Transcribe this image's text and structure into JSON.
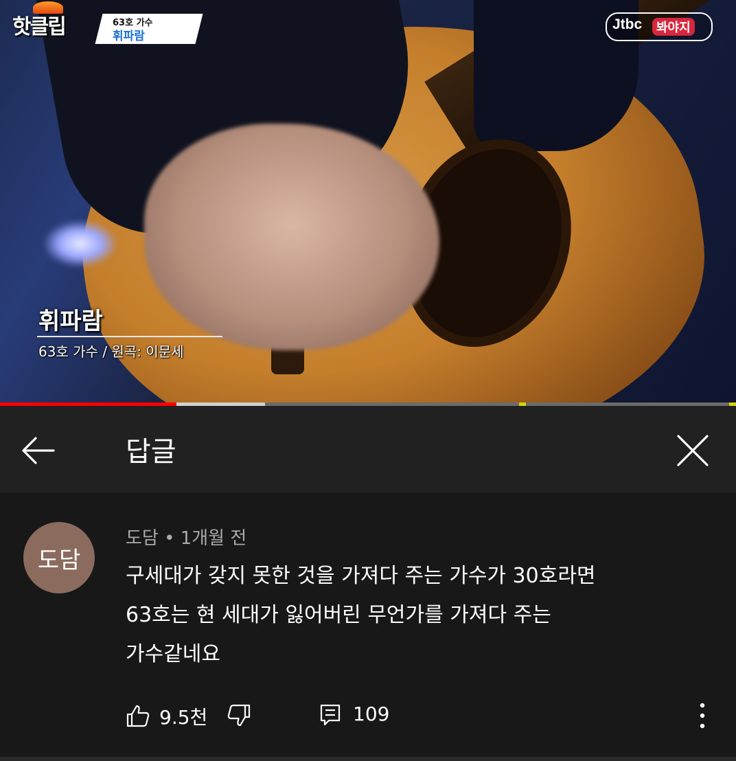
{
  "video": {
    "logo_badge": "핫클립",
    "logo_episode": "63호 가수",
    "logo_song": "휘파람",
    "channel_logo_left": "Jtbc",
    "channel_logo_right": "봐야지",
    "caption_title": "휘파람",
    "caption_subtitle": "63호 가수 / 원곡: 이문세",
    "progress": {
      "played_fraction": 0.24,
      "buffered_fraction": 0.36
    },
    "colors": {
      "played": "#ff0000",
      "buffered": "#cfcfcf",
      "track": "#6b6b6b",
      "marker": "#d6d600"
    }
  },
  "header": {
    "back_icon": "arrow-left-icon",
    "title": "답글",
    "close_icon": "close-icon"
  },
  "comment": {
    "avatar_text": "도담",
    "author": "도담",
    "separator": "•",
    "time": "1개월 전",
    "lines": [
      "구세대가 갖지 못한 것을 가져다 주는 가수가 30호라면",
      "63호는 현 세대가 잃어버린 무언가를 가져다 주는",
      "가수같네요"
    ],
    "avatar_color": "#8a6b5d"
  },
  "actions": {
    "like_icon": "thumbs-up-icon",
    "like_count": "9.5천",
    "dislike_icon": "thumbs-down-icon",
    "reply_icon": "reply-icon",
    "reply_count": "109",
    "more_icon": "more-vert-icon"
  }
}
